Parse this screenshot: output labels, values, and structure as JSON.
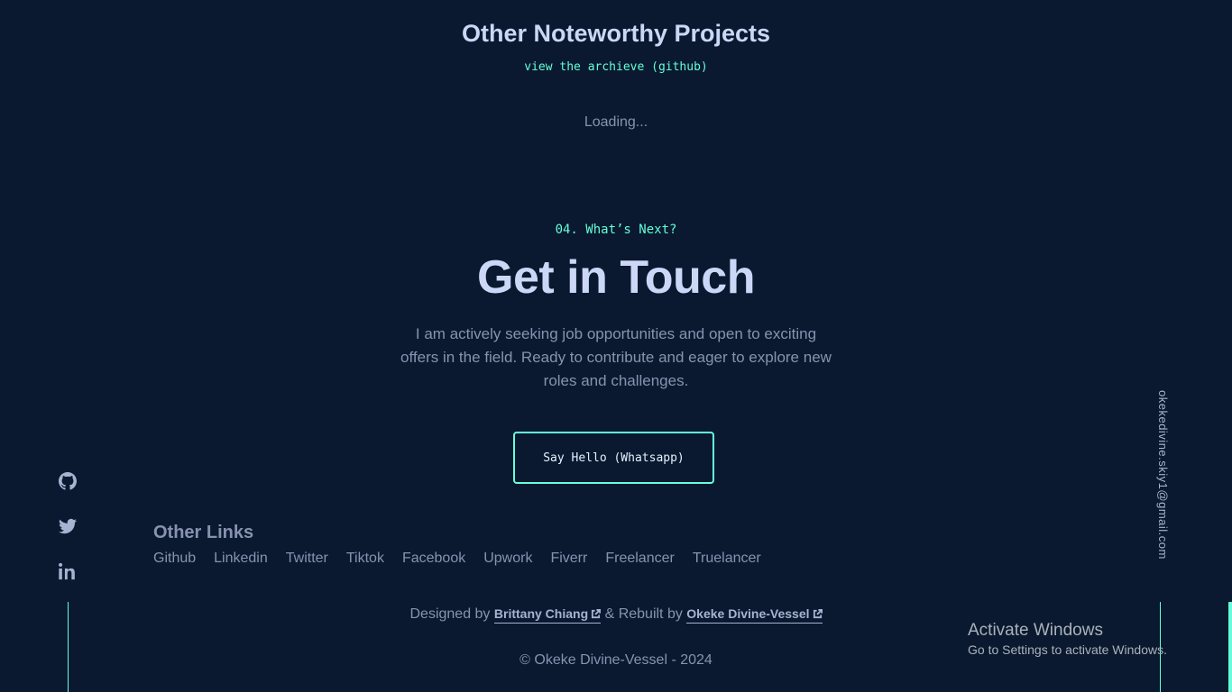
{
  "projects": {
    "title": "Other Noteworthy Projects",
    "archive_link": "view the archieve (github)",
    "loading": "Loading..."
  },
  "contact": {
    "overline": "04. What’s Next?",
    "title": "Get in Touch",
    "text": "I am actively seeking job opportunities and open to exciting offers in the field. Ready to contribute and eager to explore new roles and challenges.",
    "button_label": "Say Hello (Whatsapp)"
  },
  "social": {
    "icons": [
      "github-icon",
      "twitter-icon",
      "linkedin-icon"
    ]
  },
  "email": "okekedivine.skiy1@gmail.com",
  "other_links": {
    "title": "Other Links",
    "items": [
      "Github",
      "Linkedin",
      "Twitter",
      "Tiktok",
      "Facebook",
      "Upwork",
      "Fiverr",
      "Freelancer",
      "Truelancer"
    ]
  },
  "footer": {
    "designed_by": "Designed by",
    "designer": "Brittany Chiang",
    "rebuilt_by": "& Rebuilt by",
    "rebuilder": "Okeke Divine-Vessel",
    "copyright": "© Okeke Divine-Vessel - 2024"
  },
  "windows_watermark": {
    "title": "Activate Windows",
    "subtitle": "Go to Settings to activate Windows."
  },
  "colors": {
    "background": "#0a192f",
    "accent": "#64ffda",
    "heading": "#ccd6f6",
    "text": "#8892b0"
  }
}
